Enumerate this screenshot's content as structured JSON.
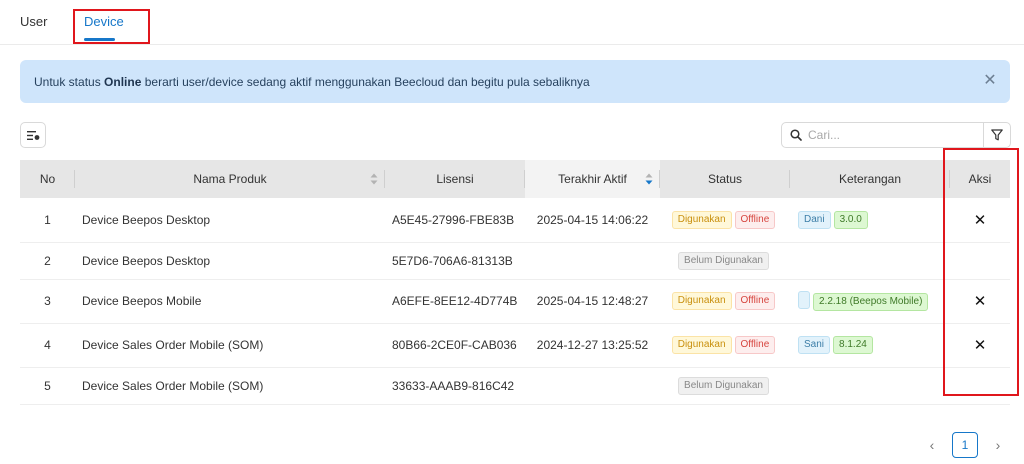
{
  "tabs": [
    {
      "label": "User"
    },
    {
      "label": "Device"
    }
  ],
  "alert": {
    "prefix": "Untuk status",
    "bold": "Online",
    "suffix": "berarti user/device sedang aktif menggunakan Beecloud dan begitu pula sebaliknya"
  },
  "search": {
    "placeholder": "Cari..."
  },
  "table": {
    "headers": {
      "no": "No",
      "nama": "Nama Produk",
      "lisensi": "Lisensi",
      "terakhir": "Terakhir Aktif",
      "status": "Status",
      "keterangan": "Keterangan",
      "aksi": "Aksi"
    },
    "rows": [
      {
        "no": "1",
        "nama": "Device Beepos Desktop",
        "lisensi": "A5E45-27996-FBE83B",
        "terakhir": "2025-04-15 14:06:22",
        "status1": "Digunakan",
        "status2": "Offline",
        "ket_user": "Dani",
        "ket_ver": "3.0.0"
      },
      {
        "no": "2",
        "nama": "Device Beepos Desktop",
        "lisensi": "5E7D6-706A6-81313B",
        "terakhir": "",
        "status1": "Belum Digunakan"
      },
      {
        "no": "3",
        "nama": "Device Beepos Mobile",
        "lisensi": "A6EFE-8EE12-4D774B",
        "terakhir": "2025-04-15 12:48:27",
        "status1": "Digunakan",
        "status2": "Offline",
        "ket_user": "",
        "ket_ver": "2.2.18 (Beepos Mobile)"
      },
      {
        "no": "4",
        "nama": "Device Sales Order Mobile (SOM)",
        "lisensi": "80B66-2CE0F-CAB036",
        "terakhir": "2024-12-27 13:25:52",
        "status1": "Digunakan",
        "status2": "Offline",
        "ket_user": "Sani",
        "ket_ver": "8.1.24"
      },
      {
        "no": "5",
        "nama": "Device Sales Order Mobile (SOM)",
        "lisensi": "33633-AAAB9-816C42",
        "terakhir": "",
        "status1": "Belum Digunakan"
      }
    ]
  },
  "pagination": {
    "current": "1"
  },
  "colors": {
    "accent": "#1677c9",
    "annotation": "#e0161c"
  },
  "icons": {
    "close": "close-icon",
    "columns": "column-settings-icon",
    "search": "search-icon",
    "filter": "filter-icon",
    "remove": "remove-icon"
  }
}
